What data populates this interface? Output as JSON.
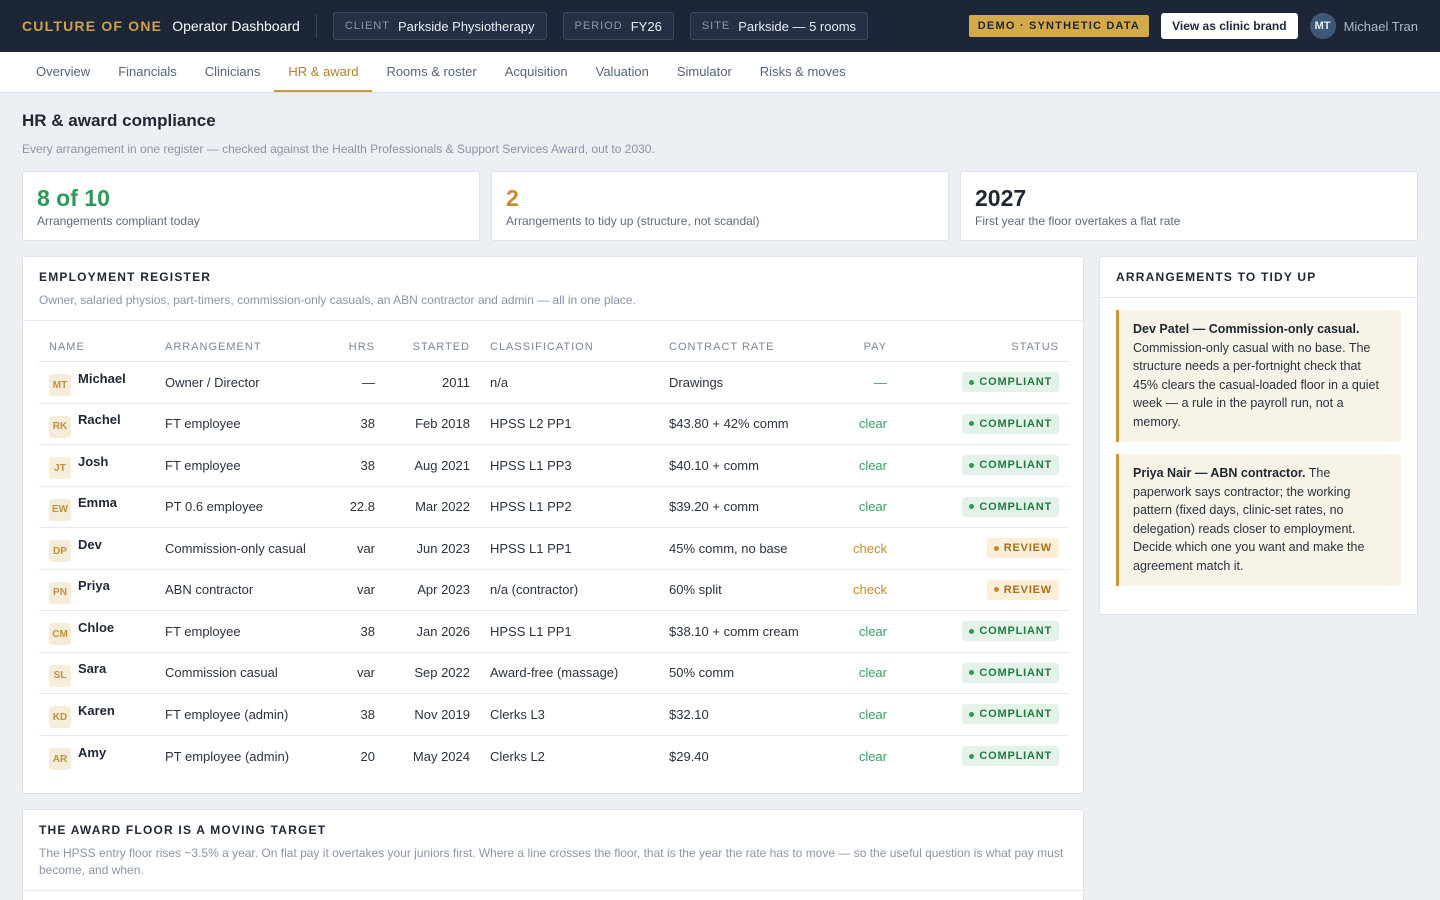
{
  "topbar": {
    "brand": "CULTURE OF ONE",
    "title": "Operator Dashboard",
    "chips": [
      {
        "key": "CLIENT",
        "value": "Parkside Physiotherapy"
      },
      {
        "key": "PERIOD",
        "value": "FY26"
      },
      {
        "key": "SITE",
        "value": "Parkside — 5 rooms"
      }
    ],
    "demo_badge": "DEMO · SYNTHETIC DATA",
    "brand_button": "View as clinic brand",
    "user_initials": "MT",
    "user_name": "Michael Tran"
  },
  "tabs": [
    "Overview",
    "Financials",
    "Clinicians",
    "HR & award",
    "Rooms & roster",
    "Acquisition",
    "Valuation",
    "Simulator",
    "Risks & moves"
  ],
  "active_tab": "HR & award",
  "page": {
    "title": "HR & award compliance",
    "subtitle": "Every arrangement in one register — checked against the Health Professionals & Support Services Award, out to 2030."
  },
  "kpis": [
    {
      "value": "8 of 10",
      "label": "Arrangements compliant today",
      "color": "#2c9a55"
    },
    {
      "value": "2",
      "label": "Arrangements to tidy up (structure, not scandal)",
      "color": "#c98a2c"
    },
    {
      "value": "2027",
      "label": "First year the floor overtakes a flat rate",
      "color": "#1f2733"
    }
  ],
  "register": {
    "title": "EMPLOYMENT REGISTER",
    "subtitle": "Owner, salaried physios, part-timers, commission-only casuals, an ABN contractor and admin — all in one place.",
    "columns": [
      "NAME",
      "ARRANGEMENT",
      "HRS",
      "STARTED",
      "CLASSIFICATION",
      "CONTRACT RATE",
      "PAY",
      "STATUS"
    ],
    "rows": [
      {
        "initials": "MT",
        "name": "Michael",
        "arrangement": "Owner / Director",
        "hrs": "—",
        "started": "2011",
        "classification": "n/a",
        "rate": "Drawings",
        "pay": "—",
        "status": "COMPLIANT"
      },
      {
        "initials": "RK",
        "name": "Rachel",
        "arrangement": "FT employee",
        "hrs": "38",
        "started": "Feb 2018",
        "classification": "HPSS L2 PP1",
        "rate": "$43.80 + 42% comm",
        "pay": "clear",
        "status": "COMPLIANT"
      },
      {
        "initials": "JT",
        "name": "Josh",
        "arrangement": "FT employee",
        "hrs": "38",
        "started": "Aug 2021",
        "classification": "HPSS L1 PP3",
        "rate": "$40.10 + comm",
        "pay": "clear",
        "status": "COMPLIANT"
      },
      {
        "initials": "EW",
        "name": "Emma",
        "arrangement": "PT 0.6 employee",
        "hrs": "22.8",
        "started": "Mar 2022",
        "classification": "HPSS L1 PP2",
        "rate": "$39.20 + comm",
        "pay": "clear",
        "status": "COMPLIANT"
      },
      {
        "initials": "DP",
        "name": "Dev",
        "arrangement": "Commission-only casual",
        "hrs": "var",
        "started": "Jun 2023",
        "classification": "HPSS L1 PP1",
        "rate": "45% comm, no base",
        "pay": "check",
        "status": "REVIEW"
      },
      {
        "initials": "PN",
        "name": "Priya",
        "arrangement": "ABN contractor",
        "hrs": "var",
        "started": "Apr 2023",
        "classification": "n/a (contractor)",
        "rate": "60% split",
        "pay": "check",
        "status": "REVIEW"
      },
      {
        "initials": "CM",
        "name": "Chloe",
        "arrangement": "FT employee",
        "hrs": "38",
        "started": "Jan 2026",
        "classification": "HPSS L1 PP1",
        "rate": "$38.10 + comm cream",
        "pay": "clear",
        "status": "COMPLIANT"
      },
      {
        "initials": "SL",
        "name": "Sara",
        "arrangement": "Commission casual",
        "hrs": "var",
        "started": "Sep 2022",
        "classification": "Award-free (massage)",
        "rate": "50% comm",
        "pay": "clear",
        "status": "COMPLIANT"
      },
      {
        "initials": "KD",
        "name": "Karen",
        "arrangement": "FT employee (admin)",
        "hrs": "38",
        "started": "Nov 2019",
        "classification": "Clerks L3",
        "rate": "$32.10",
        "pay": "clear",
        "status": "COMPLIANT"
      },
      {
        "initials": "AR",
        "name": "Amy",
        "arrangement": "PT employee (admin)",
        "hrs": "20",
        "started": "May 2024",
        "classification": "Clerks L2",
        "rate": "$29.40",
        "pay": "clear",
        "status": "COMPLIANT"
      }
    ]
  },
  "tidy": {
    "title": "ARRANGEMENTS TO TIDY UP",
    "notes": [
      {
        "lead": "Dev Patel — Commission-only casual.",
        "body": "Commission-only casual with no base. The structure needs a per-fortnight check that 45% clears the casual-loaded floor in a quiet week — a rule in the payroll run, not a memory."
      },
      {
        "lead": "Priya Nair — ABN contractor.",
        "body": "The paperwork says contractor; the working pattern (fixed days, clinic-set rates, no delegation) reads closer to employment. Decide which one you want and make the agreement match it."
      }
    ]
  },
  "floor": {
    "title": "THE AWARD FLOOR IS A MOVING TARGET",
    "subtitle": "The HPSS entry floor rises ~3.5% a year. On flat pay it overtakes your juniors first. Where a line crosses the floor, that is the year the rate has to move — so the useful question is what pay must become, and when."
  }
}
